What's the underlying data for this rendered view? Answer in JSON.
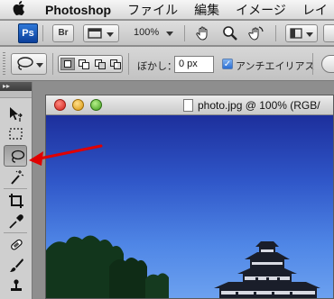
{
  "menubar": {
    "apple_icon": "apple-icon",
    "app_name": "Photoshop",
    "items": [
      "ファイル",
      "編集",
      "イメージ",
      "レイ"
    ]
  },
  "appbar": {
    "ps_label": "Ps",
    "br_label": "Br",
    "zoom": "100%"
  },
  "options": {
    "feather_label": "ぼかし：",
    "feather_value": "0 px",
    "antialias_label": "アンチエイリアス",
    "antialias_checked": true
  },
  "tools": [
    "move",
    "marquee",
    "lasso",
    "magic-wand",
    "crop",
    "eyedropper",
    "healing-brush",
    "brush",
    "clone-stamp"
  ],
  "document": {
    "title": "photo.jpg @ 100% (RGB/"
  },
  "colors": {
    "accent": "#e00000",
    "ps_blue": "#1c5cc4",
    "sky_top": "#1d2f9c",
    "sky_bottom": "#6da2f0"
  }
}
